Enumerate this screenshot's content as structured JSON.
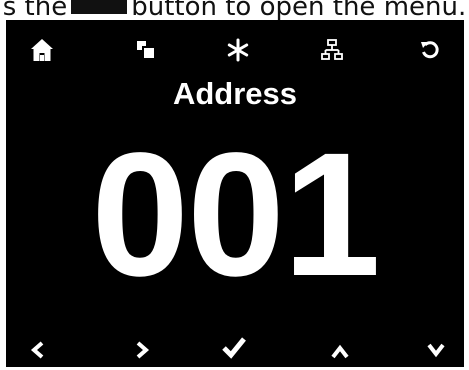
{
  "caption": {
    "before": "s the",
    "after": "button to open the menu."
  },
  "toolbar": {
    "top": [
      {
        "name": "home-icon"
      },
      {
        "name": "copy-icon"
      },
      {
        "name": "asterisk-icon"
      },
      {
        "name": "network-icon"
      },
      {
        "name": "undo-icon"
      }
    ]
  },
  "display": {
    "title": "Address",
    "value": "001"
  },
  "navbar": {
    "bottom": [
      {
        "name": "chevron-left-icon"
      },
      {
        "name": "chevron-right-icon"
      },
      {
        "name": "check-icon"
      },
      {
        "name": "chevron-up-icon"
      },
      {
        "name": "chevron-down-icon"
      }
    ]
  },
  "colors": {
    "screen_bg": "#000000",
    "foreground": "#ffffff"
  }
}
